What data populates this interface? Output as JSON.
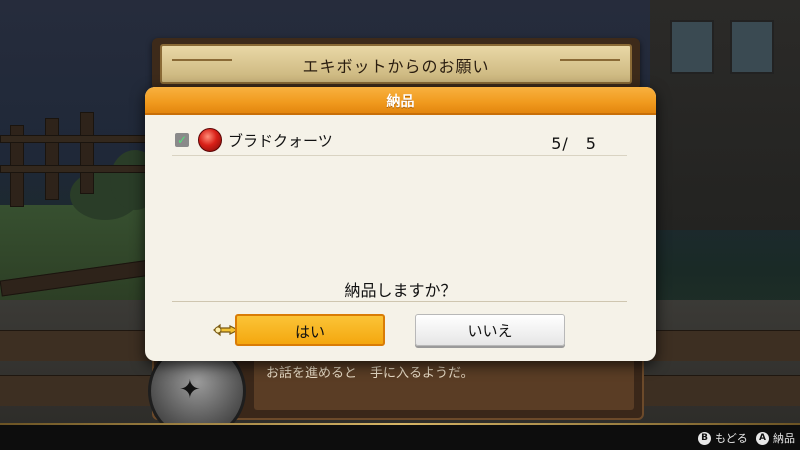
{
  "quest_banner": {
    "title": "エキボットからのお願い"
  },
  "dialogue": {
    "text": "お話を進めると　手に入るようだ。"
  },
  "modal": {
    "title": "納品",
    "items": [
      {
        "name": "ブラドクォーツ",
        "count": "5/　5",
        "checked": true,
        "icon": "red-gem-icon"
      }
    ],
    "question": "納品しますか？",
    "choices": {
      "yes": "はい",
      "no": "いいえ"
    }
  },
  "hints": {
    "back": {
      "button": "B",
      "label": "もどる"
    },
    "confirm": {
      "button": "A",
      "label": "納品"
    }
  },
  "colors": {
    "header_orange": "#f09a1e",
    "selected_button": "#f4a70f",
    "panel_bg": "#f5f2e8"
  }
}
